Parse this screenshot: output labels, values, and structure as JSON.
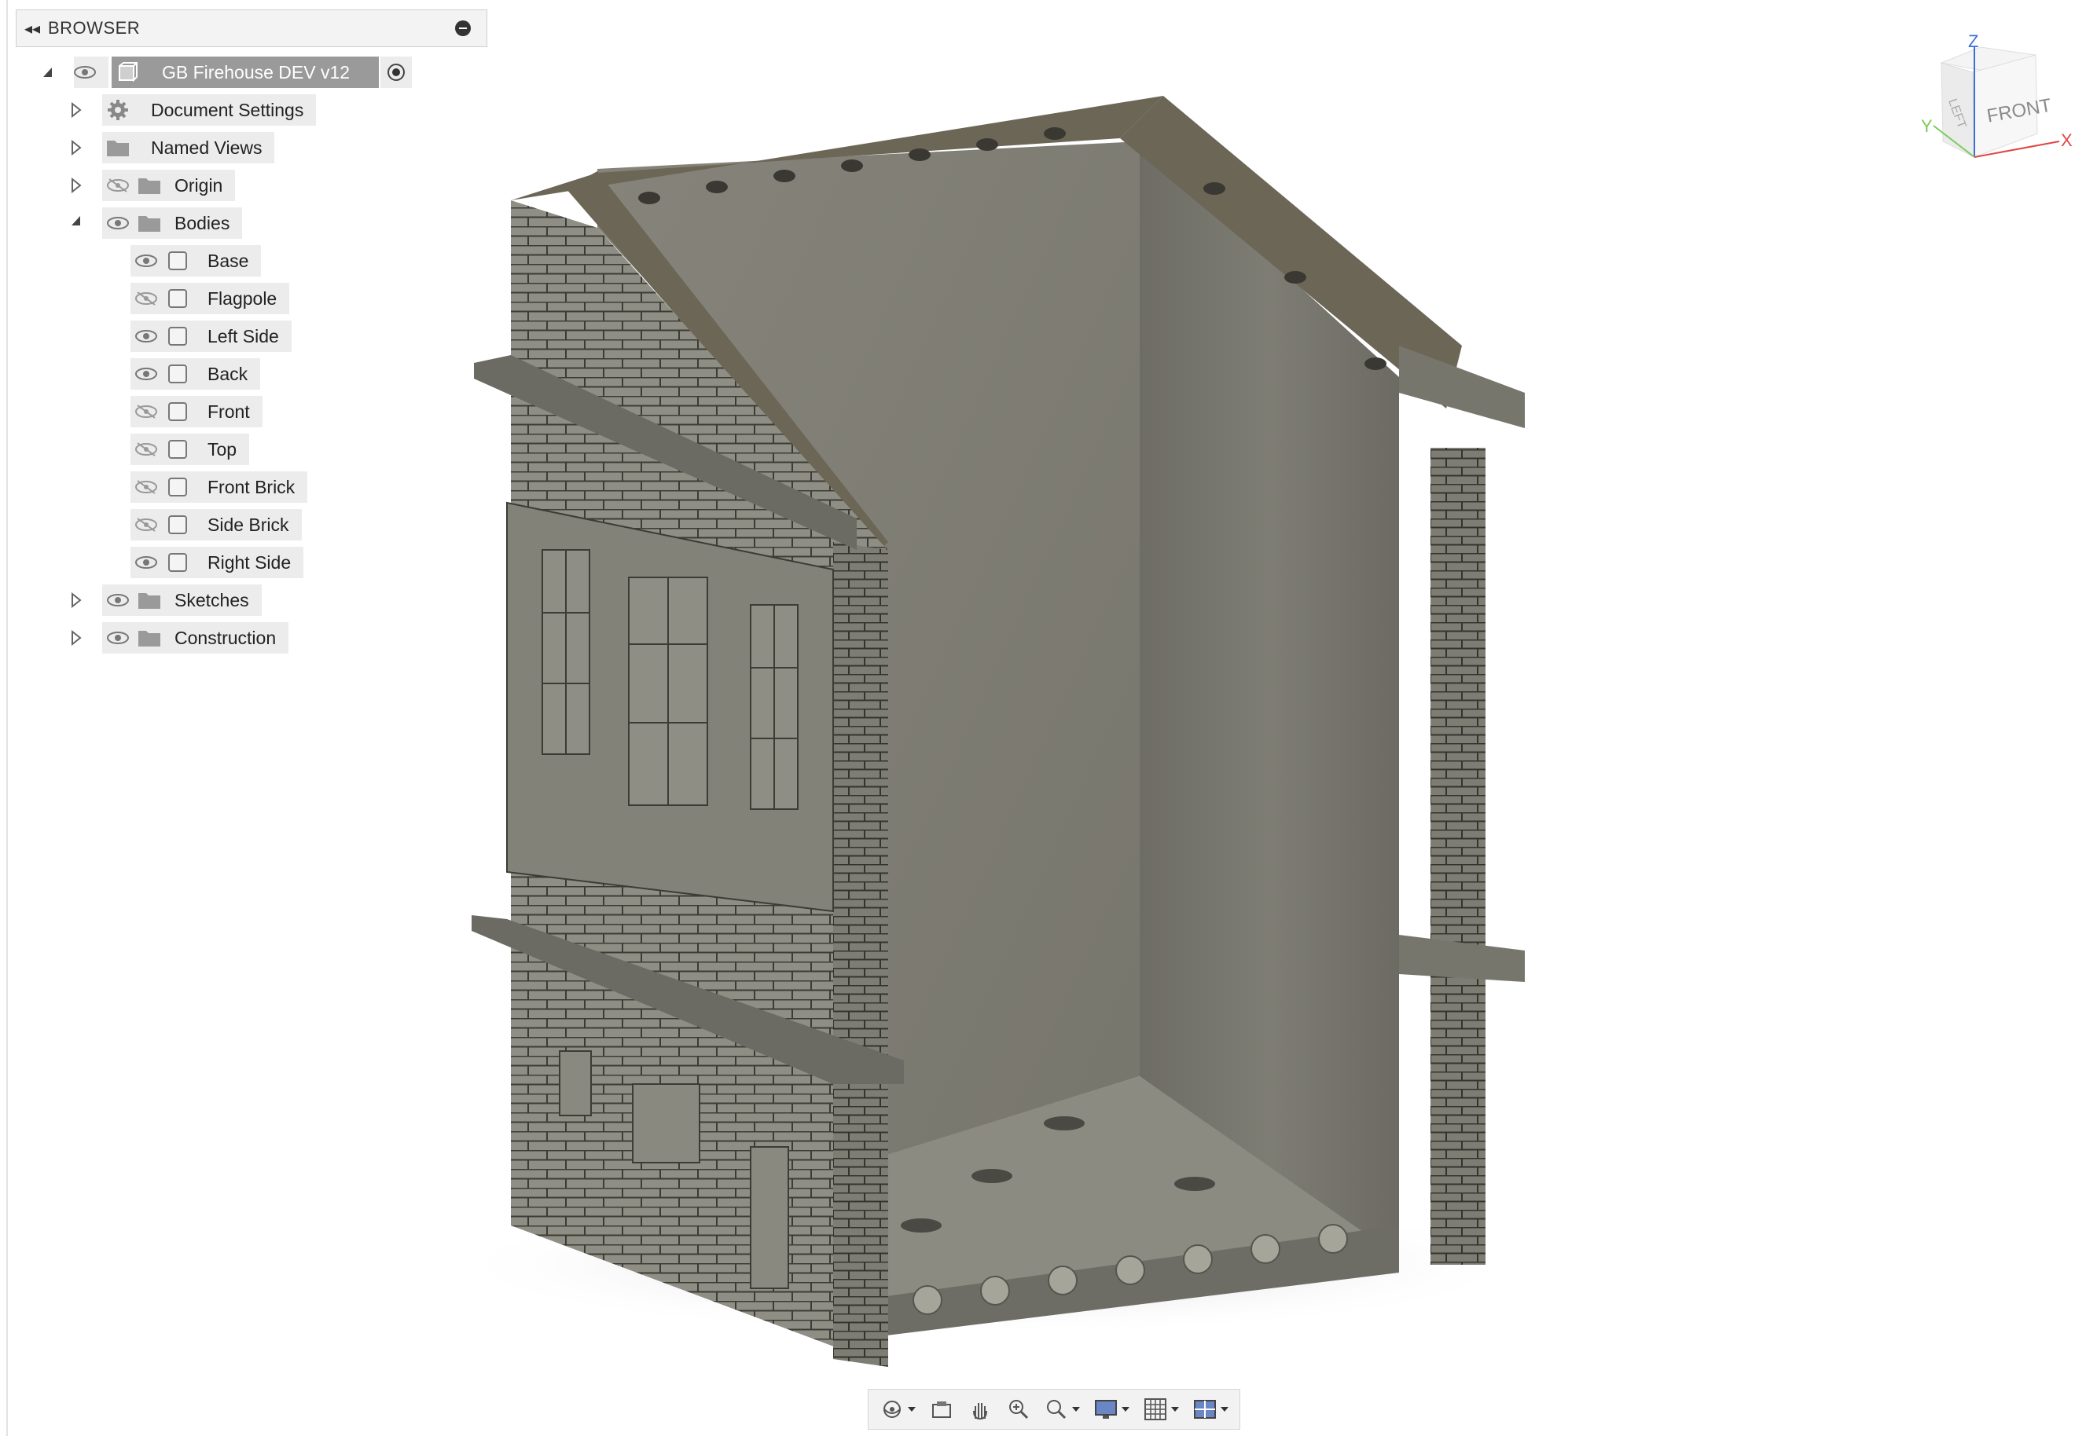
{
  "browser": {
    "title": "BROWSER",
    "root": {
      "label": "GB Firehouse DEV v12"
    },
    "items": [
      {
        "label": "Document Settings",
        "icon": "gear-icon",
        "expand": "collapsed"
      },
      {
        "label": "Named Views",
        "icon": "folder-icon",
        "expand": "collapsed"
      },
      {
        "label": "Origin",
        "icon": "folder-icon",
        "expand": "collapsed",
        "visibility": "hidden"
      },
      {
        "label": "Bodies",
        "icon": "folder-icon",
        "expand": "expanded",
        "visibility": "visible"
      },
      {
        "label": "Base",
        "icon": "body-icon",
        "visibility": "visible"
      },
      {
        "label": "Flagpole",
        "icon": "body-icon",
        "visibility": "hidden"
      },
      {
        "label": "Left Side",
        "icon": "body-icon",
        "visibility": "visible"
      },
      {
        "label": "Back",
        "icon": "body-icon",
        "visibility": "visible"
      },
      {
        "label": "Front",
        "icon": "body-icon",
        "visibility": "hidden"
      },
      {
        "label": "Top",
        "icon": "body-icon",
        "visibility": "hidden"
      },
      {
        "label": "Front Brick",
        "icon": "body-icon",
        "visibility": "hidden"
      },
      {
        "label": "Side Brick",
        "icon": "body-icon",
        "visibility": "hidden"
      },
      {
        "label": "Right Side",
        "icon": "body-icon",
        "visibility": "visible"
      },
      {
        "label": "Sketches",
        "icon": "folder-icon",
        "expand": "collapsed",
        "visibility": "visible"
      },
      {
        "label": "Construction",
        "icon": "folder-icon",
        "expand": "collapsed",
        "visibility": "visible"
      }
    ]
  },
  "viewcube": {
    "face_front": "FRONT",
    "face_left": "LEFT",
    "axis_x": "X",
    "axis_y": "Y",
    "axis_z": "Z"
  },
  "toolbar": {
    "buttons": [
      "orbit-icon",
      "look-at-icon",
      "pan-icon",
      "zoom-icon",
      "fit-icon",
      "display-settings-icon",
      "grid-icon",
      "viewports-icon"
    ]
  },
  "colors": {
    "panel_bg": "#f3f3f3",
    "selected_row": "#9a9a9a",
    "model_face": "#8a897f",
    "axis_x": "#e04545",
    "axis_y": "#7acc5a",
    "axis_z": "#3a6fd8"
  }
}
